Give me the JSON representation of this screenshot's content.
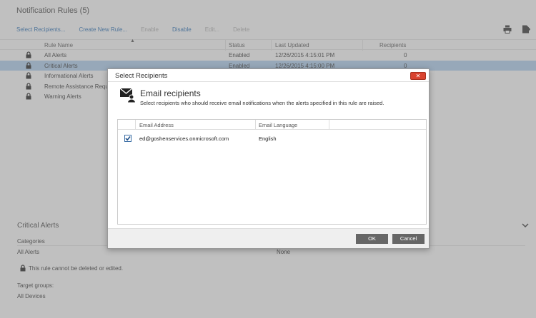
{
  "page": {
    "title": "Notification Rules (5)"
  },
  "toolbar": {
    "select_recipients": "Select Recipients...",
    "create_new_rule": "Create New Rule...",
    "enable": "Enable",
    "disable": "Disable",
    "edit": "Edit...",
    "delete": "Delete",
    "icons": [
      "print-icon",
      "export-icon"
    ]
  },
  "grid": {
    "columns": [
      "Rule Name",
      "Status",
      "Last Updated",
      "Recipients"
    ],
    "rows": [
      {
        "name": "All Alerts",
        "status": "Enabled",
        "updated": "12/26/2015 4:15:01 PM",
        "recipients": "0"
      },
      {
        "name": "Critical Alerts",
        "status": "Enabled",
        "updated": "12/26/2015 4:15:00 PM",
        "recipients": "0"
      },
      {
        "name": "Informational Alerts",
        "status": "",
        "updated": "",
        "recipients": ""
      },
      {
        "name": "Remote Assistance Reque",
        "status": "",
        "updated": "",
        "recipients": ""
      },
      {
        "name": "Warning Alerts",
        "status": "",
        "updated": "",
        "recipients": ""
      }
    ],
    "selected_index": 1
  },
  "details": {
    "title": "Critical Alerts",
    "categories_label": "Categories",
    "categories_value": "All Alerts",
    "categories_right": "None",
    "lock_note": "This rule cannot be deleted or edited.",
    "target_label": "Target groups:",
    "target_value": "All Devices"
  },
  "dialog": {
    "title": "Select Recipients",
    "heading": "Email recipients",
    "subtitle": "Select recipients who should receive email notifications when the alerts specified in this rule are raised.",
    "columns": [
      "Email Address",
      "Email Language"
    ],
    "rows": [
      {
        "checked": true,
        "email": "ed@goshenservices.onmicrosoft.com",
        "language": "English"
      }
    ],
    "ok_label": "OK",
    "cancel_label": "Cancel",
    "close_glyph": "✕"
  },
  "colors": {
    "accent": "#2a6db0",
    "selection": "#a9c9e8",
    "close": "#d9432f",
    "button": "#666666"
  }
}
